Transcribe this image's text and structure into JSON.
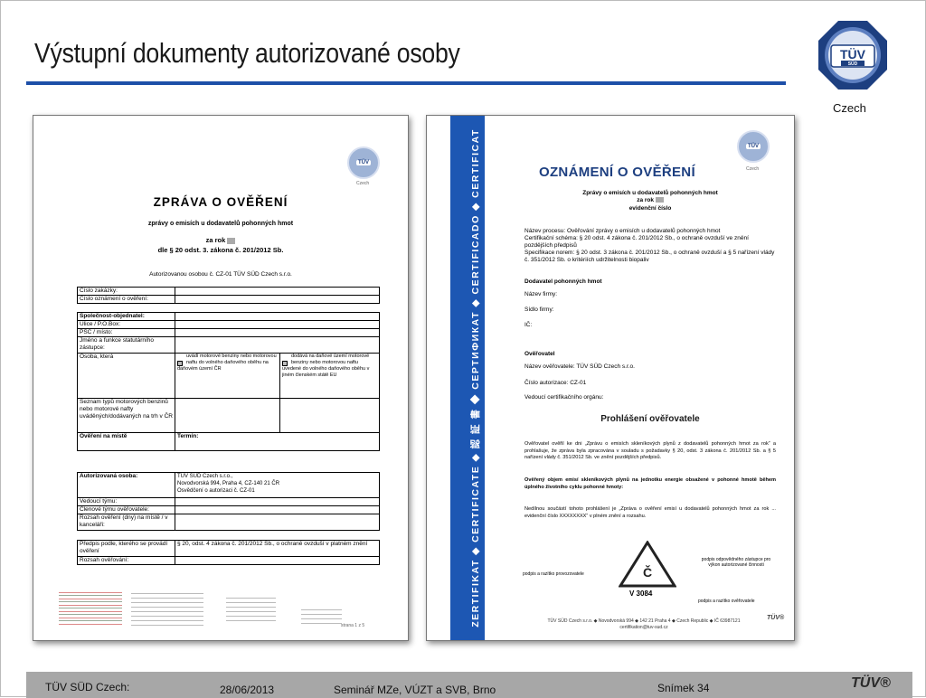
{
  "slide": {
    "title": "Výstupní dokumenty autorizované osoby",
    "logo_text": "TÜV",
    "logo_subtext": "SÜD",
    "logo_caption": "Czech"
  },
  "doc_left": {
    "mini_logo_caption": "Czech",
    "title": "ZPRÁVA O OVĚŘENÍ",
    "subtitle": "zprávy o emisích u dodavatelů pohonných hmot",
    "year_line": "za rok",
    "law_line": "dle § 20 odst. 3. zákona č. 201/2012 Sb.",
    "authorized_by": "Autorizovanou osobou č. CZ-01 TÜV SÜD Czech s.r.o.",
    "rows_top": [
      "Číslo zakázky:",
      "Číslo oznámení o ověření:"
    ],
    "rows_company": [
      "Společnost-objednatel:",
      "Ulice / P.O.Box:",
      "PSČ / místo:",
      "Jméno a funkce statutárního zástupce:"
    ],
    "osoba_label": "Osoba, která",
    "osoba_opt1": "uvádí motorové benziny nebo motorovou naftu do volného daňového oběhu na daňovém území ČR",
    "osoba_opt2": "dodává na daňové území motorové benziny nebo motorovou naftu uvedené do volného daňového oběhu v jiném členském státě EU",
    "seznam_label": "Seznam typů motorových benzinů nebo motorové nafty uváděných/dodávaných na trh v ČR",
    "overeni_label": "Ověření na místě",
    "termin_label": "Termín:",
    "ao_label": "Autorizovaná osoba:",
    "ao_value1": "TÜV SÜD Czech s.r.o.,",
    "ao_value2": "Novodvorská 994, Praha 4, CZ-140 21 ČR",
    "ao_value3": "Osvědčení o autorizaci č. CZ-01",
    "rows_team": [
      "Vedoucí týmu:",
      "Členové týmu ověřovatele:",
      "Rozsah ověření (dny) na místě / v kanceláři:"
    ],
    "predpis_label": "Předpis podle, kterého se provádí ověření",
    "predpis_value": "§ 20, odst. 4 zákona č. 201/2012 Sb., o ochraně ovzduší v platném znění",
    "rozsah_label": "Rozsah ověřování:",
    "page_num": "strana 1 z 5"
  },
  "doc_right": {
    "band_text": "ZERTIFIKAT ◆ CERTIFICATE ◆ 認 証 書 ◆ СЕРТИФИКАТ ◆ CERTIFICADO ◆ CERTIFICAT",
    "mini_logo_caption": "Czech",
    "title": "OZNÁMENÍ O OVĚŘENÍ",
    "subtitle": "Zprávy o emisích u dodavatelů pohonných hmot",
    "year_line": "za rok",
    "evid": "evidenční číslo",
    "nazev_procesu": "Název procesu: Ověřování zprávy o emisích u dodavatelů pohonných hmot",
    "cert_schema": "Certifikační schéma: § 20 odst. 4 zákona č. 201/2012 Sb., o ochraně ovzduší ve znění pozdějších předpisů",
    "spec_norem": "Specifikace norem: § 20 odst. 3 zákona č. 201/2012 Sb., o ochraně ovzduší a § 5 nařízení vlády č. 351/2012 Sb. o kritériích udržitelnosti biopaliv",
    "dodavatel_hdr": "Dodavatel pohonných hmot",
    "nazev_firmy": "Název firmy:",
    "sidlo_firmy": "Sídlo firmy:",
    "ic": "IČ:",
    "overovatel_hdr": "Ověřovatel",
    "nazev_overovatele": "Název ověřovatele: TÜV SÜD Czech s.r.o.",
    "cislo_autorizace": "Číslo autorizace: CZ-01",
    "vedouci": "Vedoucí certifikačního orgánu:",
    "prohlaseni": "Prohlášení ověřovatele",
    "text1": "Ověřovatel ověřil ke dni „Zprávu o emisích skleníkových plynů z dodavatelů pohonných hmot za rok“ a prohlašuje, že zpráva byla zpracována v souladu s požadavky § 20, odst. 3 zákona č. 201/2012 Sb. a § 5 nařízení vlády č. 351/2012 Sb. ve znění pozdějších předpisů.",
    "text2": "Ověřený objem emisí skleníkových plynů na jednotku energie obsažené v pohonné hmotě během úplného životního cyklu pohonné hmoty:",
    "text3": "Nedílnou součástí tohoto prohlášení je „Zpráva o ověření emisí u dodavatelů pohonných hmot za rok ... evidenční číslo XXXXXXXX“ v plném znění a rozsahu.",
    "sign_left": "podpis a razítko provozovatele",
    "sign_right": "podpis odpovědného zástupce pro výkon autorizované činnosti",
    "sign_right2": "podpis a razítko ověřovatele",
    "v_number": "V 3084",
    "footer_line": "TÜV SÜD Czech s.r.o. ◆ Novodvorská 994 ◆ 142 21 Praha 4 ◆ Czech Republic ◆ IČ 63987121",
    "footer_mail": "certifikation@tuv-sud.cz",
    "footer_brand": "TÜV®"
  },
  "footer": {
    "company": "TÜV SÜD Czech:",
    "date": "28/06/2013",
    "seminar": "Seminář  MZe, VÚZT a SVB, Brno",
    "slide_num": "Snímek 34",
    "brand": "TÜV®"
  },
  "colors": {
    "accent": "#1d4fa8",
    "band": "#1d57b3",
    "footer_bg": "#a7a7a7"
  }
}
